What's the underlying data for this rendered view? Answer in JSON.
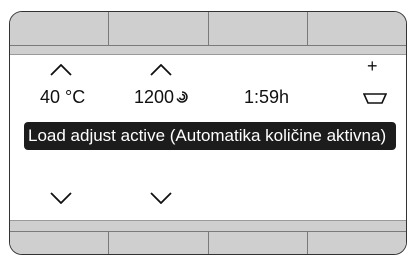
{
  "display": {
    "temperature": "40 °C",
    "spin_speed": "1200",
    "duration": "1:59h",
    "plus_label": "+",
    "status_banner": "Load adjust active (Automatika količine aktivna)"
  },
  "icons": {
    "temp_up": "chevron-up-icon",
    "temp_down": "chevron-down-icon",
    "spin_up": "chevron-up-icon",
    "spin_down": "chevron-down-icon",
    "spin": "spin-icon",
    "load": "load-basket-icon"
  },
  "colors": {
    "softkey_gray": "#cfcfcf",
    "banner_bg": "#1c1c1c",
    "banner_text": "#ffffff",
    "panel_bg": "#ffffff",
    "text": "#111111"
  }
}
